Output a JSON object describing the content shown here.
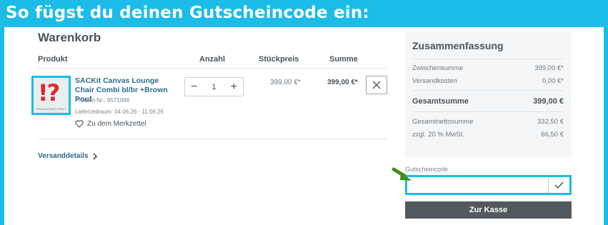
{
  "banner": {
    "title": "So fügst du deinen Gutscheincode ein:"
  },
  "cart": {
    "title": "Warenkorb",
    "columns": {
      "product": "Produkt",
      "quantity": "Anzahl",
      "unit_price": "Stückpreis",
      "total": "Summe"
    },
    "item": {
      "thumb_mark": "!?",
      "thumb_caption": "PRODUKTBILD FEHLT",
      "name": "SACKit Canvas Lounge Chair Combi bl/br +Brown Pouf",
      "product_no": "Produkt-Nr.: 9571098",
      "delivery": "Lieferzeitraum: 04.06.26 - 11.06.26",
      "wishlist": "Zu dem Merkzettel",
      "qty": "1",
      "qty_minus": "−",
      "qty_plus": "+",
      "unit_price": "399,00 €*",
      "total": "399,00 €*"
    },
    "shipping_details": "Versanddetails"
  },
  "summary": {
    "title": "Zusammenfassung",
    "rows": [
      {
        "label": "Zwischensumme",
        "value": "399,00 €*"
      },
      {
        "label": "Versandkosten",
        "value": "0,00 €*"
      }
    ],
    "grand_total": {
      "label": "Gesamtsumme",
      "value": "399,00 €"
    },
    "net_rows": [
      {
        "label": "Gesamtnettosumme",
        "value": "332,50 €"
      },
      {
        "label": "zzgl. 20 % MwSt.",
        "value": "66,50 €"
      }
    ]
  },
  "voucher": {
    "label": "Gutscheincode",
    "value": "",
    "placeholder": ""
  },
  "checkout": {
    "label": "Zur Kasse"
  },
  "colors": {
    "accent": "#1bbde8",
    "link": "#2e6a8e",
    "arrow": "#3f8f1e",
    "checkout_bg": "#535a5f"
  },
  "icons": [
    "heart-icon",
    "close-icon",
    "chevron-right-icon",
    "check-icon",
    "arrow-icon"
  ]
}
